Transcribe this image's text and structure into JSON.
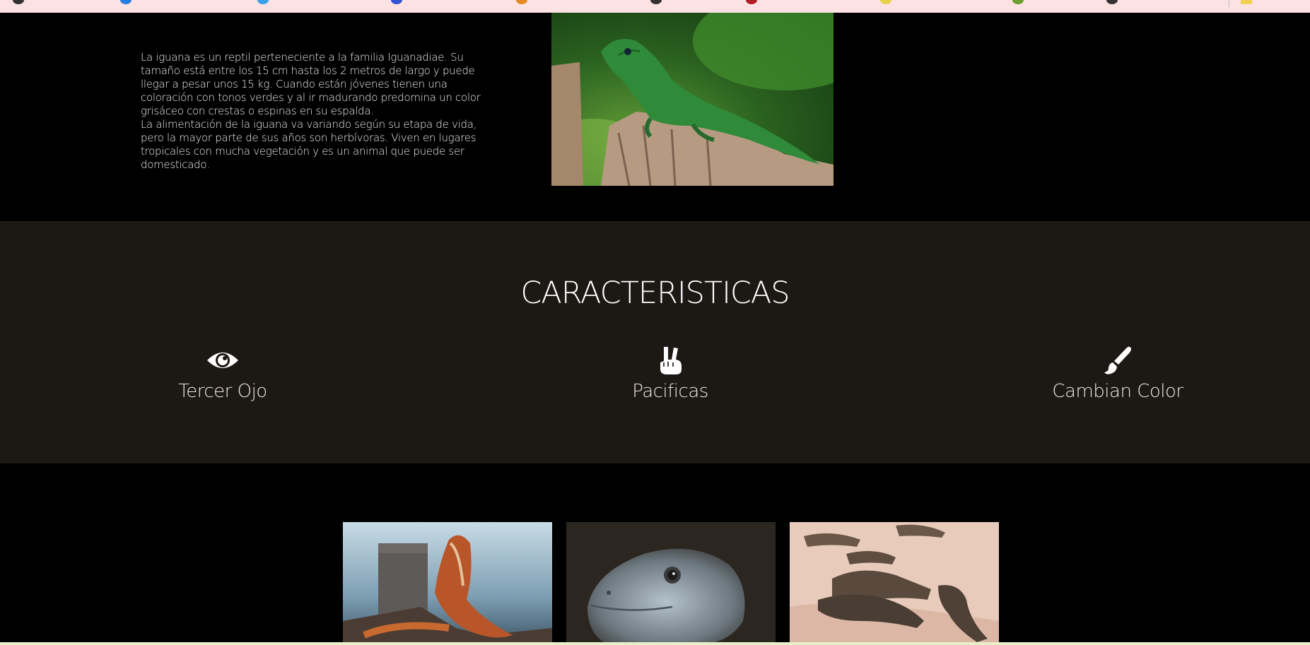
{
  "intro": {
    "paragraph_1": "La iguana es un reptil perteneciente a la familia Iguanadiae. Su tamaño está entre los 15 cm hasta los 2 metros de largo y puede llegar a pesar unos 15 kg. Cuando están jóvenes tienen una coloración con tonos verdes y al ir madurando predomina un color grisáceo con crestas o espinas en su espalda.",
    "paragraph_2": "La alimentación de la iguana va variando según su etapa de vida, pero la mayor parte de sus años son herbívoras. Viven en lugares tropicales con mucha vegetación y es un animal que puede ser domesticado."
  },
  "features": {
    "title": "CARACTERISTICAS",
    "items": [
      {
        "label": "Tercer Ojo",
        "icon": "eye-icon"
      },
      {
        "label": "Pacificas",
        "icon": "peace-hand-icon"
      },
      {
        "label": "Cambian Color",
        "icon": "paint-brush-icon"
      }
    ]
  },
  "colors": {
    "page_bg": "#000000",
    "features_bg": "#1c1814",
    "bookmarks_bg": "#fde2e4",
    "text": "#ffffff"
  }
}
